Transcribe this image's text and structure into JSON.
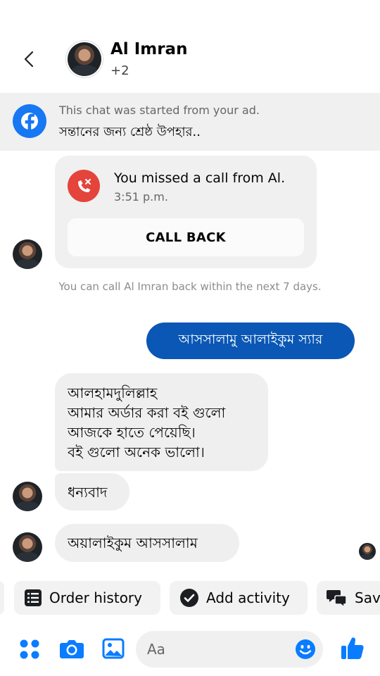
{
  "header": {
    "name": "Al Imran",
    "subtitle": "+2",
    "back_icon": "chevron-left-icon"
  },
  "ad_banner": {
    "line1": "This chat was started from your ad.",
    "line2": "সন্তানের জন্য শ্রেষ্ঠ উপহার..",
    "icon": "facebook-icon"
  },
  "call_card": {
    "title": "You missed a call from Al.",
    "time": "3:51 p.m.",
    "button_label": "CALL BACK",
    "icon": "missed-call-icon"
  },
  "call_note": "You can call Al Imran back within the next 7 days.",
  "messages": {
    "outgoing_1": "আসসালামু আলাইকুম স্যার",
    "incoming_1_lines": [
      "আলহামদুলিল্লাহ",
      "আমার অর্ডার করা বই গুলো",
      "আজকে হাতে পেয়েছি।",
      "বই গুলো অনেক ভালো।"
    ],
    "incoming_2": "ধন্যবাদ",
    "incoming_3": "অয়ালাইকুম আসসালাম"
  },
  "chips": {
    "order_history": "Order history",
    "add_activity": "Add activity",
    "save": "Sav"
  },
  "composer": {
    "placeholder": "Aa",
    "value": ""
  },
  "colors": {
    "accent": "#0a7cff",
    "outgoing_bubble": "#0a57b5",
    "incoming_bubble": "#efefef",
    "missed_call": "#e4443b",
    "facebook_blue": "#1877f2"
  }
}
